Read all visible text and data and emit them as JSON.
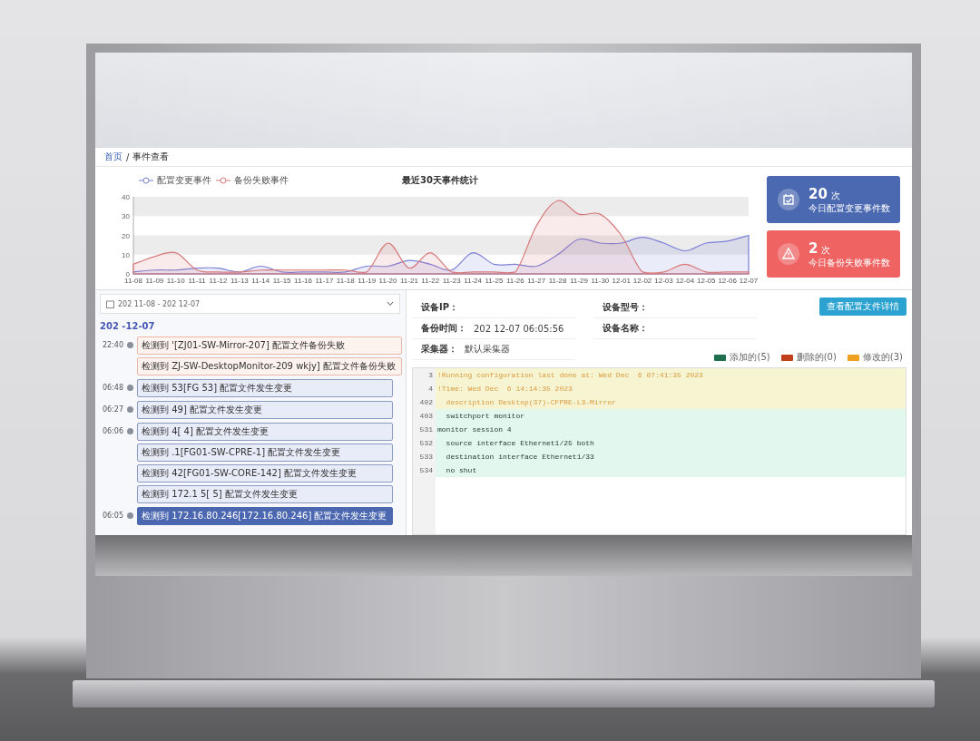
{
  "breadcrumb": {
    "home": "首页",
    "separator": "/",
    "current": "事件查看"
  },
  "chart": {
    "chart_data": {
      "type": "area",
      "title": "最近30天事件统计",
      "legend": "top-left",
      "categories": [
        "11-08",
        "11-09",
        "11-10",
        "11-11",
        "11-12",
        "11-13",
        "11-14",
        "11-15",
        "11-16",
        "11-17",
        "11-18",
        "11-19",
        "11-20",
        "11-21",
        "11-22",
        "11-23",
        "11-24",
        "11-25",
        "11-26",
        "11-27",
        "11-28",
        "11-29",
        "11-30",
        "12-01",
        "12-02",
        "12-03",
        "12-04",
        "12-05",
        "12-06",
        "12-07"
      ],
      "ylim": [
        0,
        40
      ],
      "yticks": [
        0,
        10,
        20,
        30,
        40
      ],
      "series": [
        {
          "name": "配置变更事件",
          "color": "#7b7fd6",
          "values": [
            1,
            2,
            2,
            3,
            3,
            1,
            4,
            1,
            1,
            1,
            1,
            4,
            4,
            7,
            5,
            2,
            11,
            5,
            5,
            4,
            10,
            18,
            16,
            16,
            19,
            16,
            12,
            16,
            17,
            20
          ]
        },
        {
          "name": "备份失败事件",
          "color": "#d77a7a",
          "values": [
            5,
            9,
            11,
            2,
            1,
            1,
            2,
            2,
            2,
            2,
            2,
            1,
            16,
            3,
            11,
            1,
            1,
            1,
            1,
            25,
            38,
            31,
            31,
            20,
            1,
            1,
            5,
            1,
            1,
            1
          ]
        }
      ]
    }
  },
  "cards": [
    {
      "kind": "change",
      "count": "20",
      "unit": "次",
      "label": "今日配置变更事件数"
    },
    {
      "kind": "failure",
      "count": "2",
      "unit": "次",
      "label": "今日备份失败事件数"
    }
  ],
  "date_range": {
    "value": "202   11-08 - 202   12-07"
  },
  "timeline": {
    "date": "202  -12-07",
    "groups": [
      {
        "time": "22:40",
        "items": [
          {
            "kind": "failure",
            "selected": false,
            "text": "检测到  '[ZJ01-SW-Mirror-207] 配置文件备份失败"
          },
          {
            "kind": "failure",
            "selected": false,
            "text": "检测到  ZJ-SW-DesktopMonitor-209 wkjy] 配置文件备份失败"
          }
        ]
      },
      {
        "time": "06:48",
        "items": [
          {
            "kind": "change",
            "selected": false,
            "text": "检测到  53[FG  53] 配置文件发生变更"
          }
        ]
      },
      {
        "time": "06:27",
        "items": [
          {
            "kind": "change",
            "selected": false,
            "text": "检测到  49] 配置文件发生变更"
          }
        ]
      },
      {
        "time": "06:06",
        "items": [
          {
            "kind": "change",
            "selected": false,
            "text": "检测到  4[  4] 配置文件发生变更"
          },
          {
            "kind": "change",
            "selected": false,
            "text": "检测到  .1[FG01-SW-CPRE-1] 配置文件发生变更"
          },
          {
            "kind": "change",
            "selected": false,
            "text": "检测到  42[FG01-SW-CORE-142] 配置文件发生变更"
          },
          {
            "kind": "change",
            "selected": false,
            "text": "检测到 172.1  5[  5] 配置文件发生变更"
          }
        ]
      },
      {
        "time": "06:05",
        "items": [
          {
            "kind": "change",
            "selected": true,
            "text": "检测到 172.16.80.246[172.16.80.246] 配置文件发生变更"
          }
        ]
      }
    ]
  },
  "details": {
    "fields": [
      {
        "label": "设备IP："
      },
      {
        "label": "设备型号："
      },
      {
        "label": "备份时间：",
        "value": "202   12-07 06:05:56"
      },
      {
        "label": "设备名称："
      },
      {
        "label": "采集器：",
        "value": "默认采集器"
      }
    ],
    "button": "查看配置文件详情",
    "legend": [
      {
        "label": "添加的(5)",
        "color": "#1e6e4e"
      },
      {
        "label": "删除的(0)",
        "color": "#c0401b"
      },
      {
        "label": "修改的(3)",
        "color": "#f0a020"
      }
    ],
    "code_lines": [
      {
        "number": "3",
        "kind": "modified",
        "text": "!Running configuration last done at: Wed Dec  6 07:41:35 2023"
      },
      {
        "number": "4",
        "kind": "modified",
        "text": "!Time: Wed Dec  6 14:14:35 2023"
      },
      {
        "number": "402",
        "kind": "modified",
        "text": "  description Desktop(37)-CFPRE-L3-Mirror"
      },
      {
        "number": "403",
        "kind": "added",
        "text": "  switchport monitor"
      },
      {
        "number": "531",
        "kind": "added",
        "text": "monitor session 4"
      },
      {
        "number": "532",
        "kind": "added",
        "text": "  source interface Ethernet1/25 both"
      },
      {
        "number": "533",
        "kind": "added",
        "text": "  destination interface Ethernet1/33"
      },
      {
        "number": "534",
        "kind": "added",
        "text": "  no shut"
      }
    ]
  }
}
